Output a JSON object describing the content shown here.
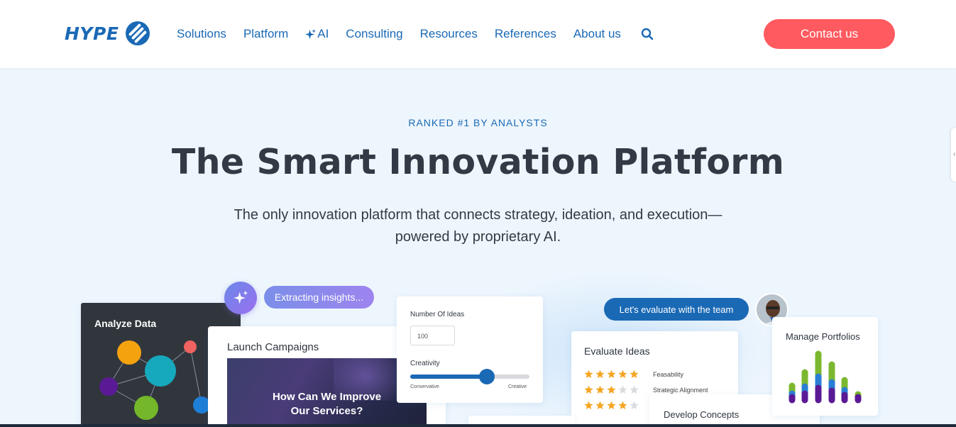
{
  "header": {
    "logo_text": "HYPE",
    "nav": [
      "Solutions",
      "Platform",
      "AI",
      "Consulting",
      "Resources",
      "References",
      "About us"
    ],
    "search_icon": "search-icon",
    "contact_label": "Contact us"
  },
  "hero": {
    "eyebrow": "RANKED #1 BY ANALYSTS",
    "title": "The Smart Innovation Platform",
    "subtitle_line1": "The only innovation platform that connects strategy, ideation, and execution—",
    "subtitle_line2": "powered by proprietary AI."
  },
  "cards": {
    "analyze_title": "Analyze Data",
    "extract_pill": "Extracting insights...",
    "launch_title": "Launch Campaigns",
    "launch_image_text_line1": "How Can We Improve",
    "launch_image_text_line2": "Our Services?",
    "ideas": {
      "number_label": "Number Of Ideas",
      "number_value": "100",
      "creativity_label": "Creativity",
      "creativity_level": 0.64,
      "min_label": "Conservative",
      "max_label": "Creative"
    },
    "team_pill": "Let's evaluate with the team",
    "evaluate_title": "Evaluate Ideas",
    "evaluate_rows": [
      {
        "label": "Feasability",
        "stars": 5
      },
      {
        "label": "Strategic Alignment",
        "stars": 3
      },
      {
        "label": "",
        "stars": 4
      }
    ],
    "develop_title": "Develop Concepts",
    "manage_title": "Manage Portfolios"
  },
  "colors": {
    "brand": "#1a69b5",
    "cta": "#ff5a5f",
    "background": "#eef6fd",
    "star": "#f5a623",
    "star_empty": "#d9dcdf"
  }
}
